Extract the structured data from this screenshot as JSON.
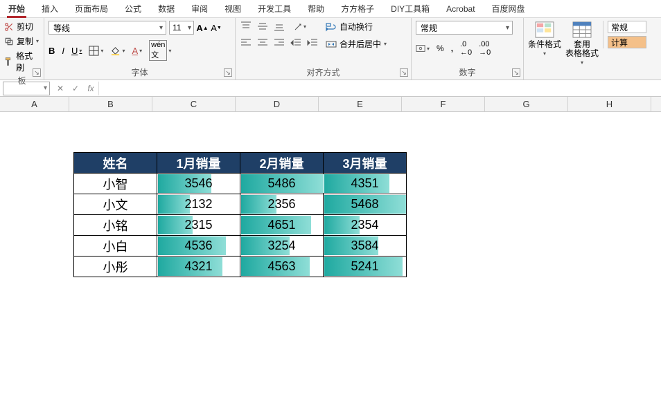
{
  "tabs": {
    "items": [
      "开始",
      "插入",
      "页面布局",
      "公式",
      "数据",
      "审阅",
      "视图",
      "开发工具",
      "帮助",
      "方方格子",
      "DIY工具箱",
      "Acrobat",
      "百度网盘"
    ],
    "active_index": 0
  },
  "clipboard": {
    "cut": "剪切",
    "copy": "复制",
    "format_painter": "格式刷",
    "group_label": "板"
  },
  "font": {
    "name": "等线",
    "size": "11",
    "group_label": "字体"
  },
  "alignment": {
    "wrap_text": "自动换行",
    "merge_center": "合并后居中",
    "group_label": "对齐方式"
  },
  "number": {
    "format": "常规",
    "group_label": "数字"
  },
  "styles": {
    "cond_format": "条件格式",
    "table_format_l1": "套用",
    "table_format_l2": "表格格式",
    "cell_style_normal": "常规",
    "cell_style_calc": "计算"
  },
  "formula_bar": {
    "name_box": "",
    "cancel": "✕",
    "enter": "✓",
    "fx": "fx",
    "formula": ""
  },
  "columns": {
    "labels": [
      "A",
      "B",
      "C",
      "D",
      "E",
      "F",
      "G",
      "H"
    ],
    "widths": [
      100,
      120,
      120,
      120,
      120,
      120,
      120,
      120
    ]
  },
  "table": {
    "headers": [
      "姓名",
      "1月销量",
      "2月销量",
      "3月销量"
    ],
    "rows": [
      {
        "name": "小智",
        "vals": [
          3546,
          5486,
          4351
        ]
      },
      {
        "name": "小文",
        "vals": [
          2132,
          2356,
          5468
        ]
      },
      {
        "name": "小铭",
        "vals": [
          2315,
          4651,
          2354
        ]
      },
      {
        "name": "小白",
        "vals": [
          4536,
          3254,
          3584
        ]
      },
      {
        "name": "小彤",
        "vals": [
          4321,
          4563,
          5241
        ]
      }
    ],
    "databar_max": 5500
  },
  "chart_data": {
    "type": "table",
    "title": "",
    "columns": [
      "姓名",
      "1月销量",
      "2月销量",
      "3月销量"
    ],
    "rows": [
      [
        "小智",
        3546,
        5486,
        4351
      ],
      [
        "小文",
        2132,
        2356,
        5468
      ],
      [
        "小铭",
        2315,
        4651,
        2354
      ],
      [
        "小白",
        4536,
        3254,
        3584
      ],
      [
        "小彤",
        4321,
        4563,
        5241
      ]
    ]
  }
}
